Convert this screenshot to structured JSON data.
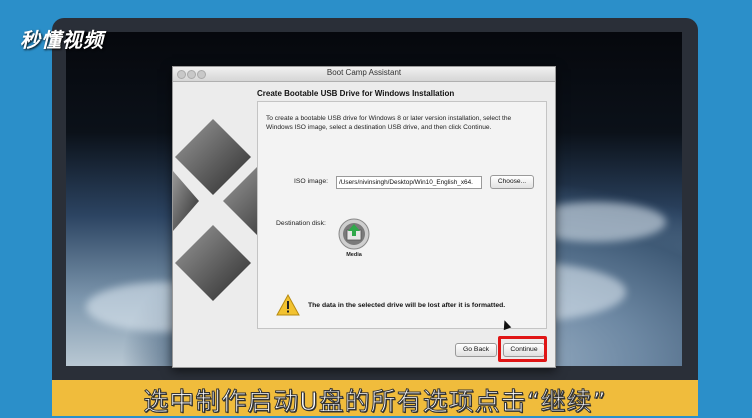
{
  "brand": {
    "logo_text": "秒懂视频"
  },
  "window": {
    "title": "Boot Camp Assistant"
  },
  "content": {
    "heading": "Create Bootable USB Drive for Windows Installation",
    "description": "To create a bootable USB drive for Windows 8 or later version installation, select the Windows ISO image, select a destination USB drive, and then click Continue.",
    "iso_label": "ISO image:",
    "iso_value": "/Users/nivinsingh/Desktop/Win10_English_x64.",
    "choose_label": "Choose...",
    "destination_label": "Destination disk:",
    "media_label": "Media",
    "warning_text": "The data in the selected drive will be lost after it is formatted."
  },
  "buttons": {
    "go_back": "Go Back",
    "continue": "Continue"
  },
  "subtitle": {
    "text": "选中制作启动U盘的所有选项点击“继续”"
  },
  "colors": {
    "frame_bg": "#2b8fc9",
    "subtitle_bar": "#f0bc3c",
    "highlight": "#e01515"
  }
}
